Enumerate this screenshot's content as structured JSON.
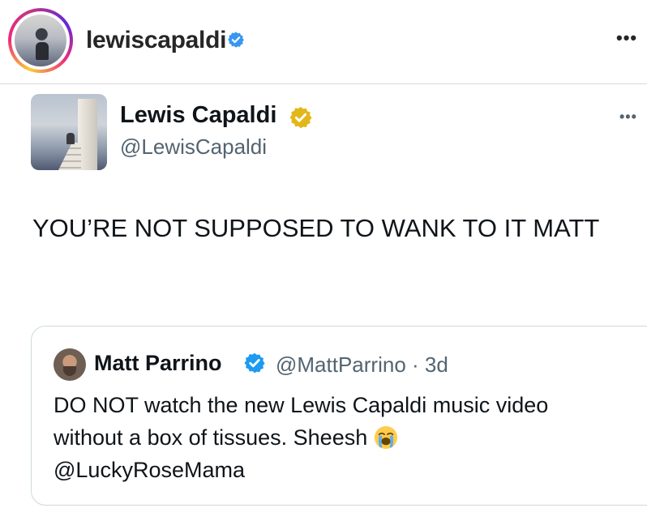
{
  "instagram": {
    "username": "lewiscapaldi",
    "menu_icon": "more-horizontal-icon",
    "accent": "#3897f0"
  },
  "tweet": {
    "author_name": "Lewis Capaldi",
    "author_handle": "@LewisCapaldi",
    "verified_badge_color": "#e2b719",
    "text": "YOU’RE NOT SUPPOSED TO WANK TO IT MATT",
    "menu_icon": "more-horizontal-icon"
  },
  "quoted_tweet": {
    "author_name": "Matt Parrino",
    "author_handle": "@MattParrino",
    "separator": "·",
    "time": "3d",
    "text": "DO NOT watch the new Lewis Capaldi music video without a box of tissues. Sheesh",
    "emoji": "loudly-crying-face-icon",
    "mention": "@LuckyRoseMama",
    "verified_badge_color": "#1d9bf0"
  }
}
